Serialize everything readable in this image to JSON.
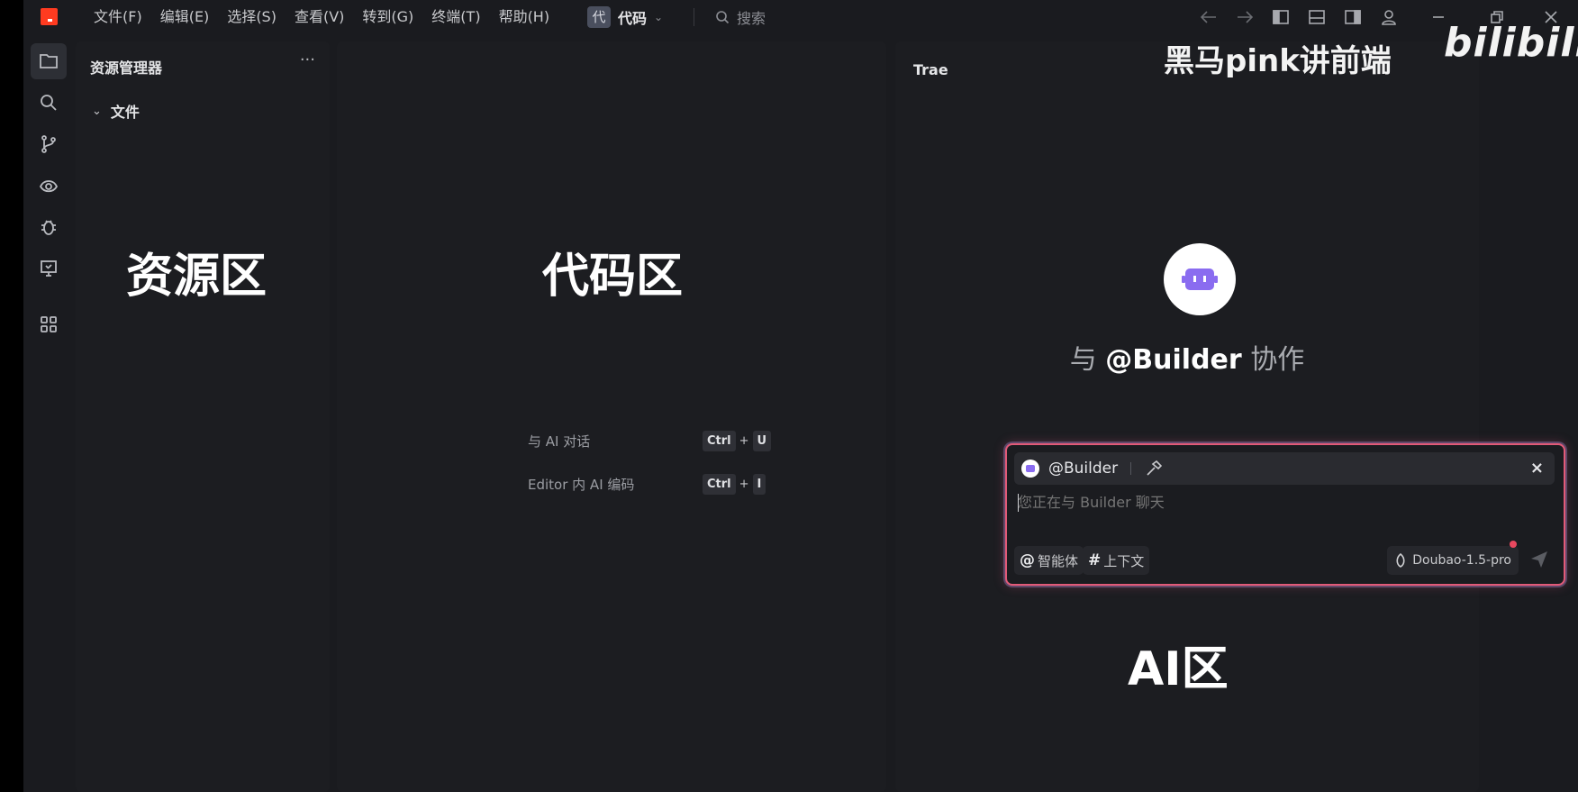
{
  "menu": [
    "文件(F)",
    "编辑(E)",
    "选择(S)",
    "查看(V)",
    "转到(G)",
    "终端(T)",
    "帮助(H)"
  ],
  "workspace": {
    "badge": "代",
    "name": "代码"
  },
  "search": {
    "placeholder": "搜索"
  },
  "watermark": {
    "author": "黑马pink讲前端",
    "site": "bilibili"
  },
  "explorer": {
    "title": "资源管理器",
    "more": "···",
    "folder": "文件",
    "region_label": "资源区"
  },
  "editor": {
    "region_label": "代码区",
    "shortcuts": [
      {
        "label": "与 AI 对话",
        "keys": [
          "Ctrl",
          "U"
        ]
      },
      {
        "label": "Editor 内 AI 编码",
        "keys": [
          "Ctrl",
          "I"
        ]
      }
    ]
  },
  "ai": {
    "title": "Trae",
    "collab_prefix": "与",
    "collab_agent": "@Builder",
    "collab_suffix": "协作",
    "chat": {
      "agent": "@Builder",
      "close": "×",
      "placeholder": "您正在与 Builder 聊天",
      "chip_agent": "智能体",
      "chip_context": "上下文",
      "model": "Doubao-1.5-pro"
    },
    "region_label": "AI区"
  },
  "colors": {
    "accent_red": "#e25a78",
    "bot_purple": "#8a6cf0",
    "logo": "#ff3b20"
  }
}
